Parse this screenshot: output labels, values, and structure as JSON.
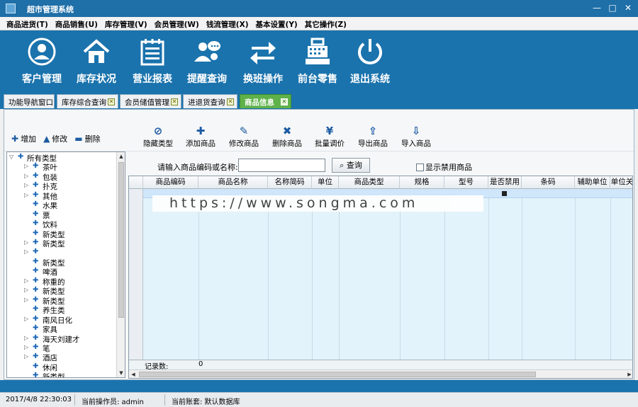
{
  "window": {
    "title": "超市管理系统",
    "controls": [
      "—",
      "□",
      "✕"
    ]
  },
  "menu": [
    "商品进货(T)",
    "商品销售(U)",
    "库存管理(V)",
    "会员管理(W)",
    "钱流管理(X)",
    "基本设置(Y)",
    "其它操作(Z)"
  ],
  "bigtoolbar": [
    {
      "label": "客户管理",
      "icon": "user-icon"
    },
    {
      "label": "库存状况",
      "icon": "home-icon"
    },
    {
      "label": "营业报表",
      "icon": "report-icon"
    },
    {
      "label": "提醒查询",
      "icon": "reminder-users-icon"
    },
    {
      "label": "换班操作",
      "icon": "swap-icon"
    },
    {
      "label": "前台零售",
      "icon": "cash-register-icon"
    },
    {
      "label": "退出系统",
      "icon": "power-icon"
    }
  ],
  "tabs": [
    {
      "label": "功能导航窗口",
      "closable": false,
      "active": false
    },
    {
      "label": "库存综合查询",
      "closable": true,
      "active": false
    },
    {
      "label": "会员储值管理",
      "closable": true,
      "active": false
    },
    {
      "label": "进退货查询",
      "closable": true,
      "active": false
    },
    {
      "label": "商品信息",
      "closable": true,
      "active": true
    }
  ],
  "lefttools": [
    {
      "label": "增加",
      "glyph": "✚"
    },
    {
      "label": "修改",
      "glyph": "▲"
    },
    {
      "label": "删除",
      "glyph": "▬"
    }
  ],
  "righttools": [
    {
      "label": "隐藏类型",
      "glyph": "⊘"
    },
    {
      "label": "添加商品",
      "glyph": "✚"
    },
    {
      "label": "修改商品",
      "glyph": "✎"
    },
    {
      "label": "删除商品",
      "glyph": "✖"
    },
    {
      "label": "批量调价",
      "glyph": "¥"
    },
    {
      "label": "导出商品",
      "glyph": "⇪"
    },
    {
      "label": "导入商品",
      "glyph": "⇩"
    }
  ],
  "tree": {
    "root": "所有类型",
    "items": [
      "茶叶",
      "包装",
      "扑克",
      "其他",
      "水果",
      "票",
      "饮料",
      "新类型",
      "新类型",
      "",
      "新类型",
      "啤酒",
      "称重的",
      "新类型",
      "新类型",
      "养生类",
      "南风日化",
      "家具",
      "海天刘建才",
      "笔",
      "酒店",
      "休闲",
      "新类型"
    ]
  },
  "search": {
    "label": "请输入商品编码或名称:",
    "value": "",
    "button": "查询",
    "checkbox_label": "显示禁用商品",
    "checked": false
  },
  "grid": {
    "columns": [
      "商品编码",
      "商品名称",
      "名称简码",
      "单位",
      "商品类型",
      "规格",
      "型号",
      "是否禁用",
      "条码",
      "辅助单位",
      "单位关"
    ],
    "footer_label": "记录数:",
    "footer_value": "0"
  },
  "overlay_url": "https://www.songma.com",
  "status": {
    "datetime": "2017/4/8 22:30:03",
    "operator": "当前操作员: admin",
    "account": "当前账套: 默认数据库"
  },
  "colors": {
    "accent": "#1a73ad",
    "active_tab": "#5fb24a"
  }
}
